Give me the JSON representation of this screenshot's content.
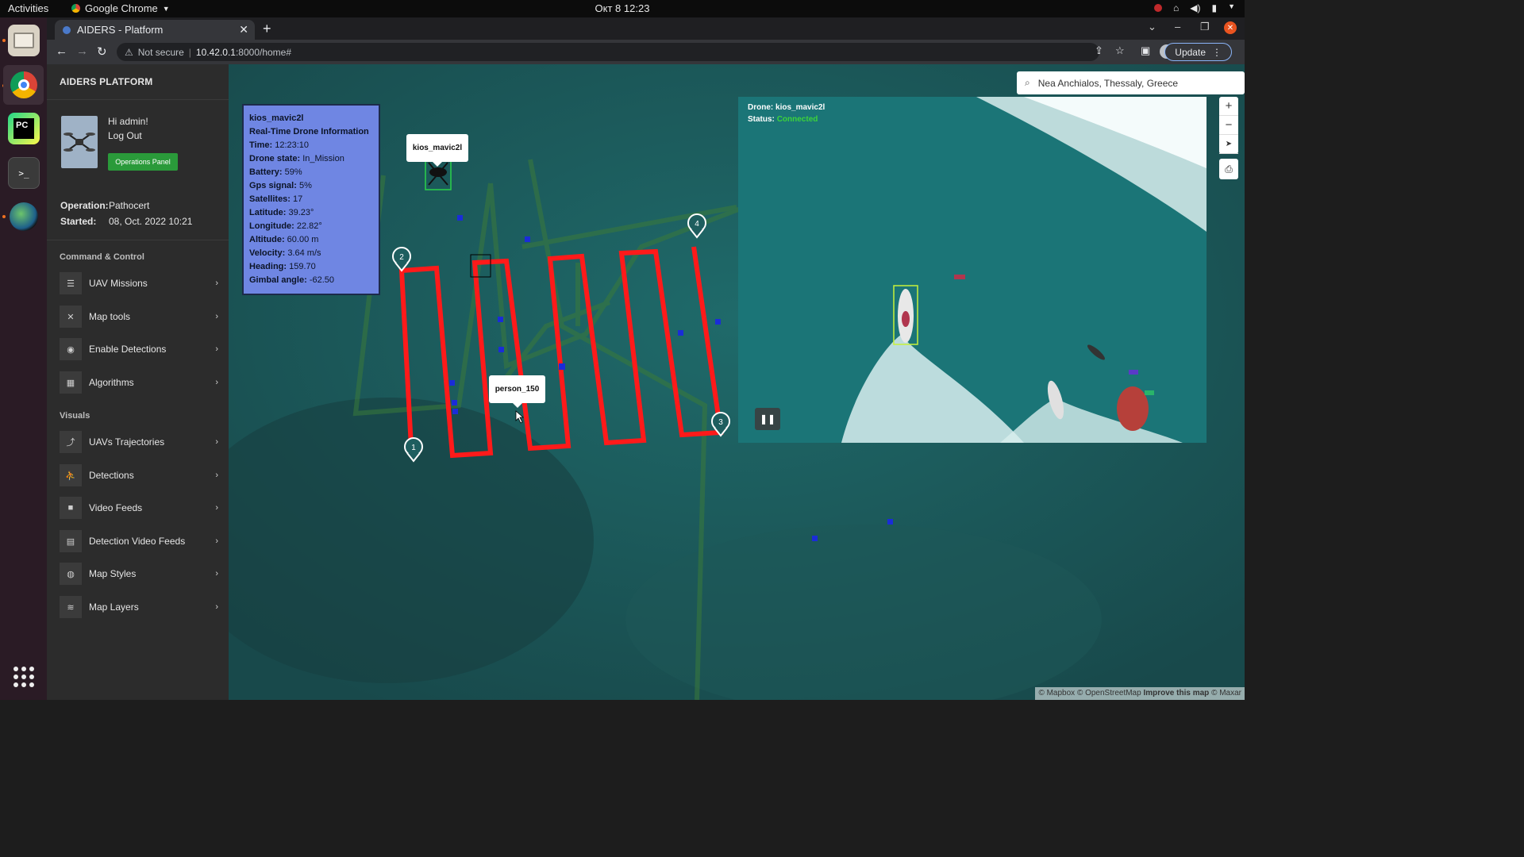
{
  "os": {
    "activities": "Activities",
    "app_name": "Google Chrome",
    "clock": "Окт 8  12:23"
  },
  "browser": {
    "tab_title": "AIDERS - Platform",
    "security": "Not secure",
    "url_host": "10.42.0.1",
    "url_path": ":8000/home#",
    "update_label": "Update"
  },
  "sidebar": {
    "brand": "AIDERS PLATFORM",
    "greeting": "Hi admin!",
    "logout": "Log Out",
    "ops_button": "Operations Panel",
    "operation_label": "Operation:",
    "operation_value": "Pathocert",
    "started_label": "Started:",
    "started_value": "08, Oct. 2022 10:21",
    "section_control": "Command & Control",
    "section_visuals": "Visuals",
    "control_items": [
      {
        "label": "UAV Missions",
        "icon": "list-icon"
      },
      {
        "label": "Map tools",
        "icon": "tools-icon"
      },
      {
        "label": "Enable Detections",
        "icon": "eye-icon"
      },
      {
        "label": "Algorithms",
        "icon": "calculator-icon"
      }
    ],
    "visual_items": [
      {
        "label": "UAVs Trajectories",
        "icon": "route-icon"
      },
      {
        "label": "Detections",
        "icon": "detection-icon"
      },
      {
        "label": "Video Feeds",
        "icon": "video-icon"
      },
      {
        "label": "Detection Video Feeds",
        "icon": "film-icon"
      },
      {
        "label": "Map Styles",
        "icon": "globe-icon"
      },
      {
        "label": "Map Layers",
        "icon": "layers-icon"
      }
    ]
  },
  "drone_info": {
    "name": "kios_mavic2l",
    "heading_text": "Real-Time Drone Information",
    "rows": [
      {
        "label": "Time:",
        "value": "12:23:10"
      },
      {
        "label": "Drone state:",
        "value": "In_Mission"
      },
      {
        "label": "Battery:",
        "value": "59%"
      },
      {
        "label": "Gps signal:",
        "value": "5%"
      },
      {
        "label": "Satellites:",
        "value": "17"
      },
      {
        "label": "Latitude:",
        "value": "39.23°"
      },
      {
        "label": "Longitude:",
        "value": "22.82°"
      },
      {
        "label": "Altitude:",
        "value": "60.00 m"
      },
      {
        "label": "Velocity:",
        "value": "3.64 m/s"
      },
      {
        "label": "Heading:",
        "value": "159.70"
      },
      {
        "label": "Gimbal angle:",
        "value": "-62.50"
      }
    ]
  },
  "map": {
    "drone_tooltip": "kios_mavic2l",
    "person_tooltip": "person_150",
    "search_value": "Nea Anchialos, Thessaly, Greece",
    "waypoints": [
      "1",
      "2",
      "3",
      "4"
    ],
    "video_drone_label": "Drone:",
    "video_drone_value": "kios_mavic2l",
    "video_status_label": "Status:",
    "video_status_value": "Connected",
    "attribution_1": "© Mapbox © OpenStreetMap",
    "attribution_2": "Improve this map",
    "attribution_3": "© Maxar"
  },
  "colors": {
    "path_red": "#ff1a1a",
    "info_panel": "#6f86e3",
    "connected_green": "#3cd23c",
    "ops_button": "#2a9a3a"
  }
}
